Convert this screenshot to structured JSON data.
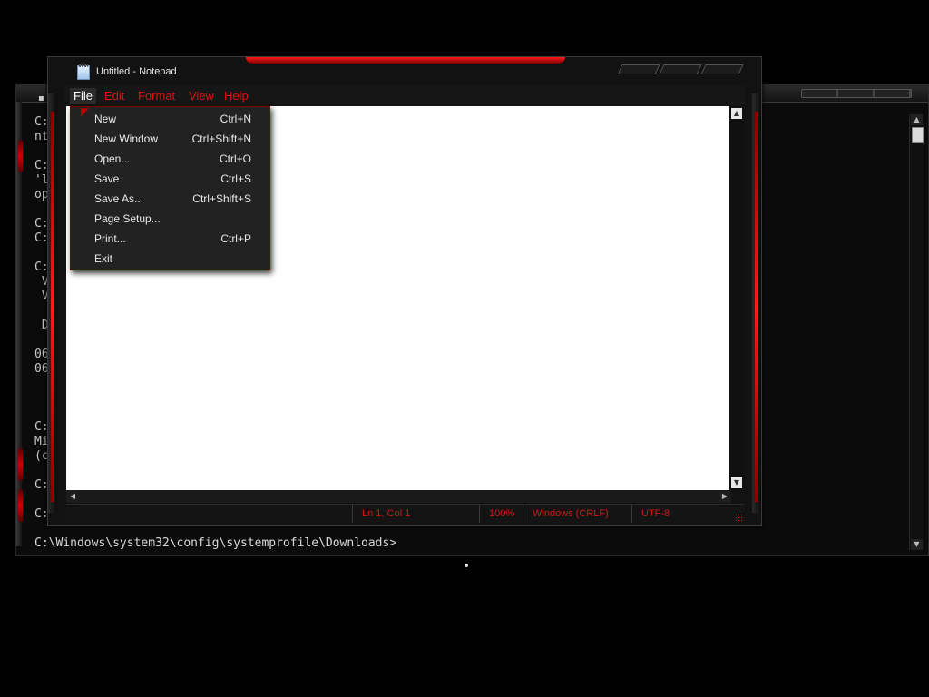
{
  "console": {
    "lines": [
      "C:",
      "nt",
      "",
      "C:",
      "'l",
      "op",
      "",
      "C:",
      "C:",
      "",
      "C:",
      " V",
      " V",
      "",
      " D",
      "",
      "06",
      "06",
      "",
      "",
      "",
      "C:",
      "Mi",
      "(c",
      "",
      "C:",
      "",
      "C:"
    ],
    "prompt": "C:\\Windows\\system32\\config\\systemprofile\\Downloads>"
  },
  "notepad": {
    "title": "Untitled - Notepad",
    "menus": [
      "File",
      "Edit",
      "Format",
      "View",
      "Help"
    ],
    "active_menu": "File",
    "status": {
      "position": "Ln 1, Col 1",
      "zoom": "100%",
      "line_ending": "Windows (CRLF)",
      "encoding": "UTF-8"
    }
  },
  "file_menu": {
    "items": [
      {
        "label": "New",
        "shortcut": "Ctrl+N"
      },
      {
        "label": "New Window",
        "shortcut": "Ctrl+Shift+N"
      },
      {
        "label": "Open...",
        "shortcut": "Ctrl+O"
      },
      {
        "label": "Save",
        "shortcut": "Ctrl+S"
      },
      {
        "label": "Save As...",
        "shortcut": "Ctrl+Shift+S"
      },
      {
        "label": "Page Setup...",
        "shortcut": ""
      },
      {
        "label": "Print...",
        "shortcut": "Ctrl+P"
      },
      {
        "label": "Exit",
        "shortcut": ""
      }
    ]
  },
  "colors": {
    "accent": "#e01010",
    "menu_bg": "#222222",
    "editor_bg": "#ffffff"
  },
  "icons": {
    "app": "notepad-icon",
    "scroll_up": "arrow-up-icon",
    "scroll_down": "arrow-down-icon",
    "scroll_left": "arrow-left-icon",
    "scroll_right": "arrow-right-icon"
  }
}
